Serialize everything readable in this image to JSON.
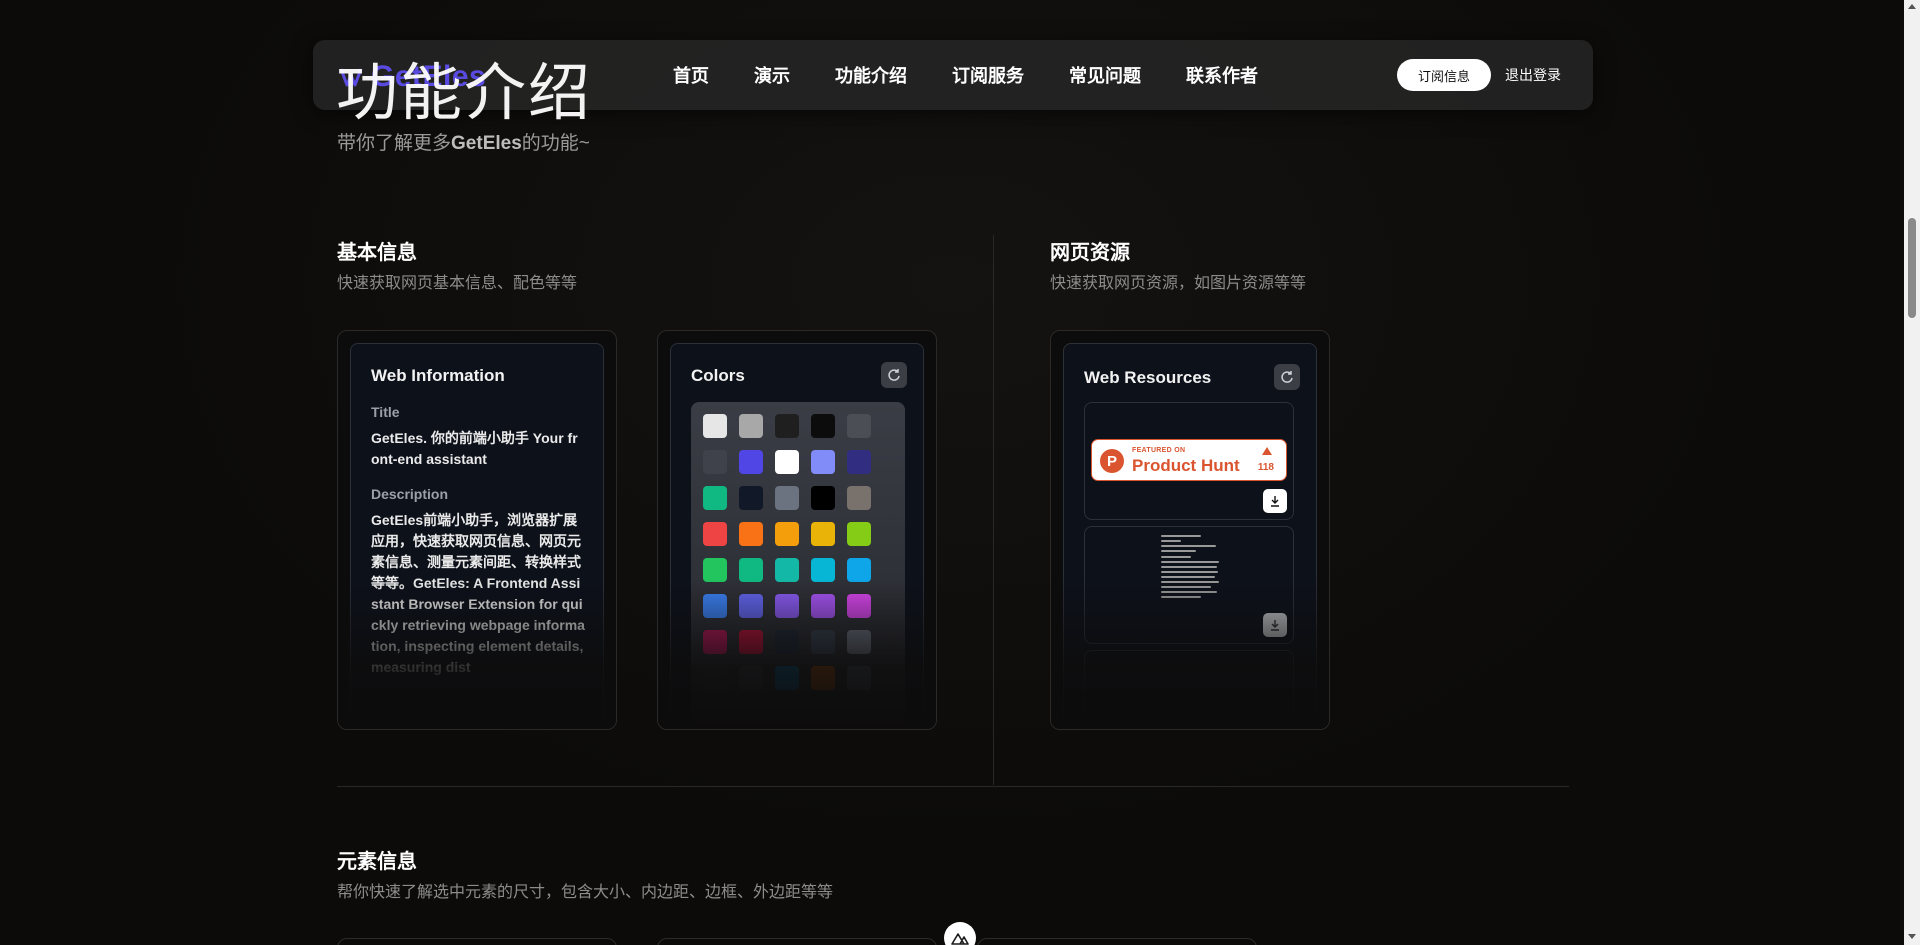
{
  "header": {
    "logo_text": "GetEles",
    "nav": [
      "首页",
      "演示",
      "功能介绍",
      "订阅服务",
      "常见问题",
      "联系作者"
    ],
    "subscribe_label": "订阅信息",
    "logout_label": "退出登录"
  },
  "page": {
    "title": "功能介绍",
    "subtitle_prefix": "带你了解更多",
    "subtitle_brand": "GetEles",
    "subtitle_suffix": "的功能~"
  },
  "sections": {
    "basic": {
      "title": "基本信息",
      "desc": "快速获取网页基本信息、配色等等"
    },
    "resources": {
      "title": "网页资源",
      "desc": "快速获取网页资源，如图片资源等等"
    },
    "element": {
      "title": "元素信息",
      "desc": "帮你快速了解选中元素的尺寸，包含大小、内边距、边框、外边距等等"
    }
  },
  "web_info": {
    "heading": "Web Information",
    "title_label": "Title",
    "title_value": "GetEles. 你的前端小助手 Your front-end assistant",
    "desc_label": "Description",
    "desc_value": "GetEles前端小助手，浏览器扩展应用，快速获取网页信息、网页元素信息、测量元素间距、转换样式等等。GetEles: A Frontend Assistant Browser Extension for quickly retrieving webpage information, inspecting element details, measuring dist"
  },
  "colors_card": {
    "heading": "Colors",
    "swatches": [
      "#e6e6e6",
      "#a8a8a8",
      "#1f1f1f",
      "#0c0c0c",
      "#4b4e55",
      "#3f424a",
      "#4f46e5",
      "#ffffff",
      "#818cf8",
      "#312e81",
      "#10b981",
      "#111827",
      "#6b7280",
      "#000000",
      "#78716c",
      "#ef4444",
      "#f97316",
      "#f59e0b",
      "#eab308",
      "#84cc16",
      "#22c55e",
      "#10b981",
      "#14b8a6",
      "#06b6d4",
      "#0ea5e9",
      "#3b82f6",
      "#6366f1",
      "#8b5cf6",
      "#a855f7",
      "#d946ef",
      "#be185d",
      "#be123c",
      "#1f2937",
      "#374151",
      "#6b7280",
      "#2d2f35",
      "#3a3d45",
      "#0369a1",
      "#b45309",
      "#4b5563"
    ]
  },
  "resources_card": {
    "heading": "Web Resources",
    "ph_small": "FEATURED ON",
    "ph_big": "Product Hunt",
    "ph_count": "118"
  },
  "colors": {
    "accent": "#5a4be0",
    "ph": "#da552f"
  }
}
